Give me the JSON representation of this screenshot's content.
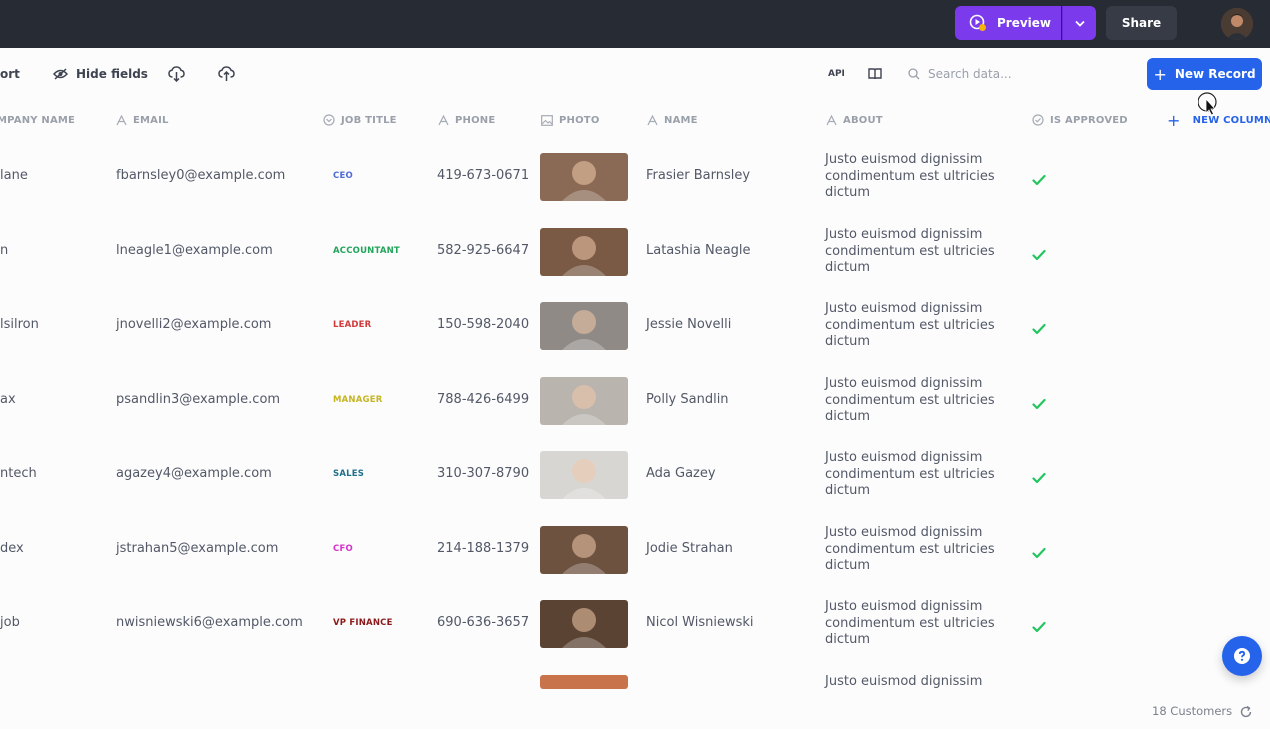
{
  "topbar": {
    "preview_label": "Preview",
    "share_label": "Share"
  },
  "toolbar": {
    "sort_label": "ort",
    "hide_fields_label": "Hide fields",
    "api_label": "API",
    "search_placeholder": "Search data...",
    "new_record_label": "New Record"
  },
  "columns": {
    "company": "MPANY NAME",
    "email": "EMAIL",
    "job_title": "JOB TITLE",
    "phone": "PHONE",
    "photo": "PHOTO",
    "name": "NAME",
    "about": "ABOUT",
    "is_approved": "IS APPROVED",
    "new_column": "NEW COLUMN"
  },
  "rows": [
    {
      "company": "lane",
      "email": "fbarnsley0@example.com",
      "job": "CEO",
      "job_color": "#4f6bd6",
      "phone": "419-673-0671",
      "name": "Frasier Barnsley",
      "about1": "Justo euismod dignissim",
      "about2": "condimentum est ultricies",
      "about3": "dictum",
      "photo_color": "#8a6a55"
    },
    {
      "company": "n",
      "email": "lneagle1@example.com",
      "job": "ACCOUNTANT",
      "job_color": "#22a55a",
      "phone": "582-925-6647",
      "name": "Latashia Neagle",
      "about1": "Justo euismod dignissim",
      "about2": "condimentum est ultricies",
      "about3": "dictum",
      "photo_color": "#7a5a45"
    },
    {
      "company": "lsilron",
      "email": "jnovelli2@example.com",
      "job": "LEADER",
      "job_color": "#d03a3a",
      "phone": "150-598-2040",
      "name": "Jessie Novelli",
      "about1": "Justo euismod dignissim",
      "about2": "condimentum est ultricies",
      "about3": "dictum",
      "photo_color": "#8f8a86"
    },
    {
      "company": "ax",
      "email": "psandlin3@example.com",
      "job": "MANAGER",
      "job_color": "#c5b520",
      "phone": "788-426-6499",
      "name": "Polly Sandlin",
      "about1": "Justo euismod dignissim",
      "about2": "condimentum est ultricies",
      "about3": "dictum",
      "photo_color": "#b9b4ae"
    },
    {
      "company": "ntech",
      "email": "agazey4@example.com",
      "job": "SALES",
      "job_color": "#1f6f8b",
      "phone": "310-307-8790",
      "name": "Ada Gazey",
      "about1": "Justo euismod dignissim",
      "about2": "condimentum est ultricies",
      "about3": "dictum",
      "photo_color": "#d8d6d3"
    },
    {
      "company": "dex",
      "email": "jstrahan5@example.com",
      "job": "CFO",
      "job_color": "#d631c9",
      "phone": "214-188-1379",
      "name": "Jodie Strahan",
      "about1": "Justo euismod dignissim",
      "about2": "condimentum est ultricies",
      "about3": "dictum",
      "photo_color": "#6e5240"
    },
    {
      "company": "job",
      "email": "nwisniewski6@example.com",
      "job": "VP FINANCE",
      "job_color": "#8b1a1a",
      "phone": "690-636-3657",
      "name": "Nicol Wisniewski",
      "about1": "Justo euismod dignissim",
      "about2": "condimentum est ultricies",
      "about3": "dictum",
      "photo_color": "#5b4333"
    }
  ],
  "partial_row": {
    "about1": "Justo euismod dignissim",
    "photo_color": "#c9734a"
  },
  "footer": {
    "count_label": "18 Customers"
  },
  "colors": {
    "accent": "#2563eb",
    "preview": "#7c3aed",
    "check": "#22c55e",
    "topbar": "#272b33"
  }
}
